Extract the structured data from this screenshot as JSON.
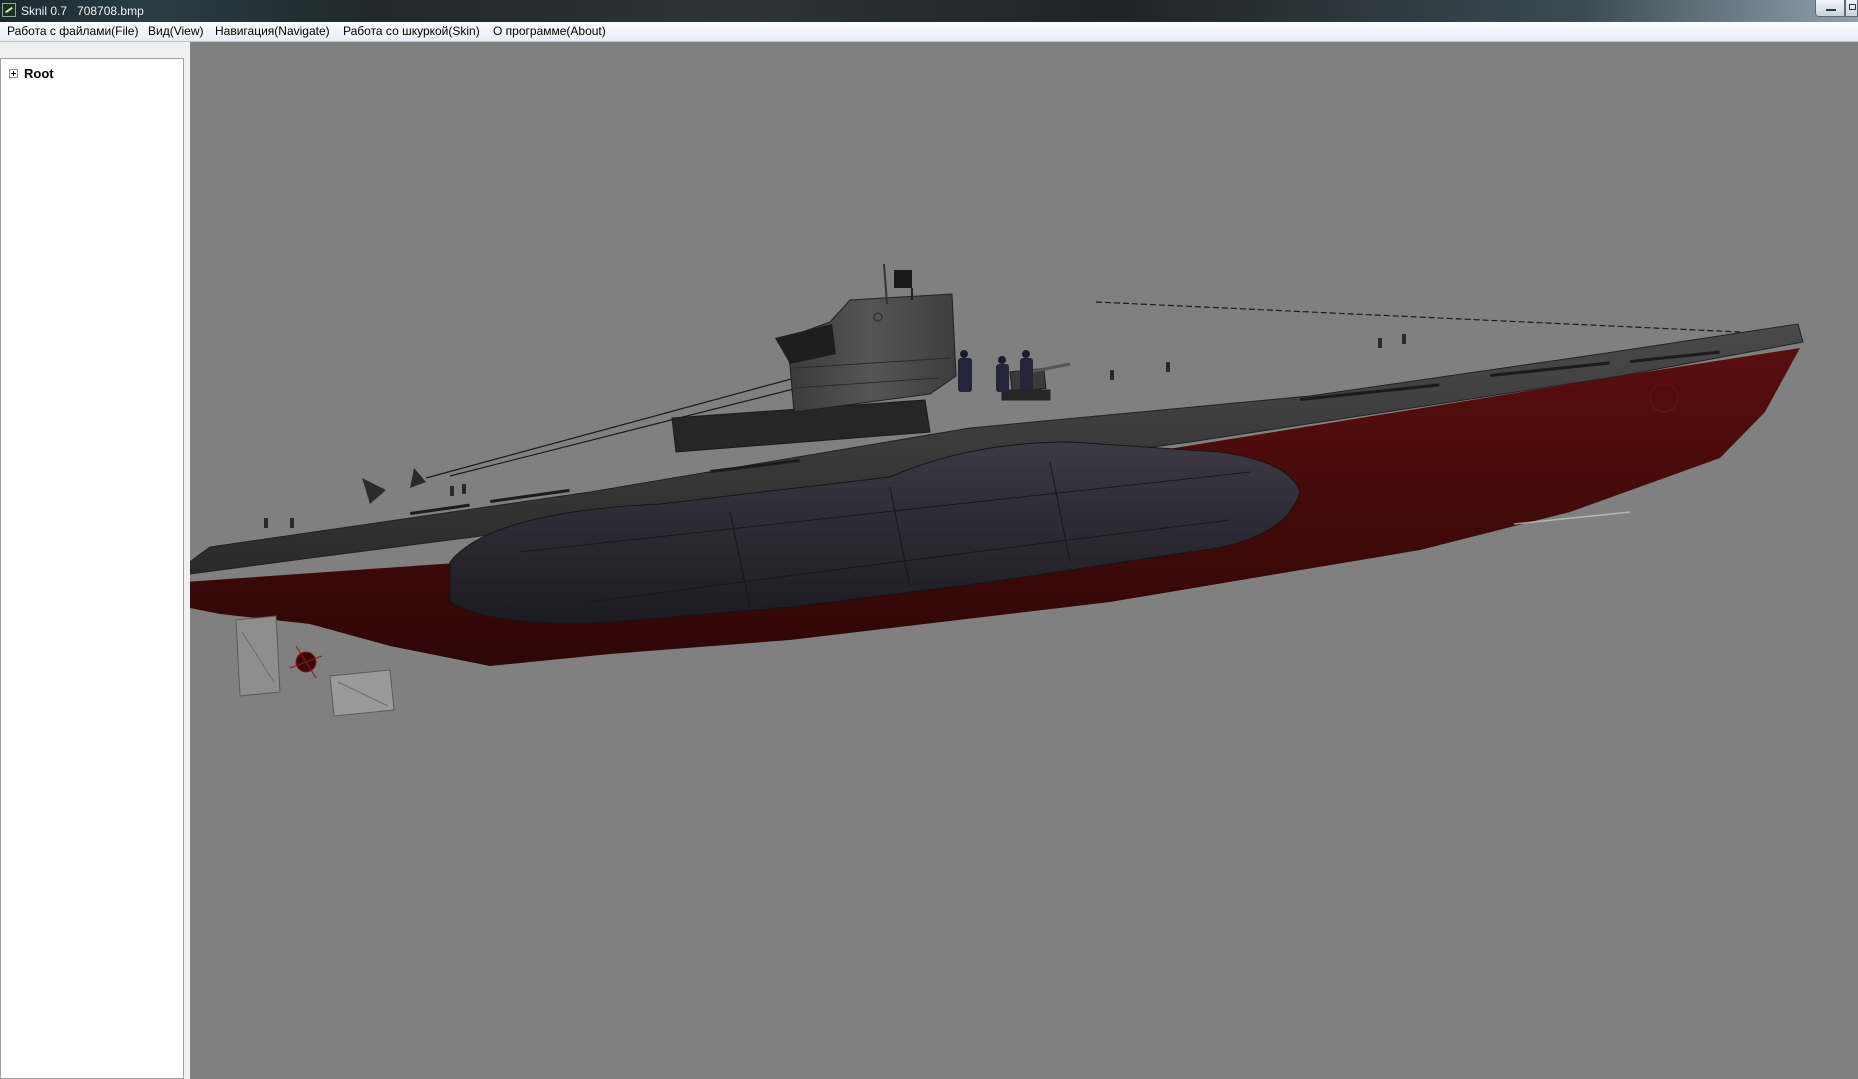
{
  "window": {
    "app_name": "Sknil 0.7",
    "file_name": "708708.bmp"
  },
  "menu": {
    "items": [
      {
        "label": "Работа с файлами(File)"
      },
      {
        "label": "Вид(View)"
      },
      {
        "label": "Навигация(Navigate)"
      },
      {
        "label": "Работа со шкуркой(Skin)"
      },
      {
        "label": "О программе(About)"
      }
    ]
  },
  "tree": {
    "root_label": "Root"
  },
  "viewport": {
    "background_color": "#808080",
    "model": "submarine-3d-model"
  },
  "icons": {
    "app": "app-icon",
    "expand": "plus-expander-icon",
    "minimize": "minimize-icon",
    "maximize": "maximize-icon"
  }
}
